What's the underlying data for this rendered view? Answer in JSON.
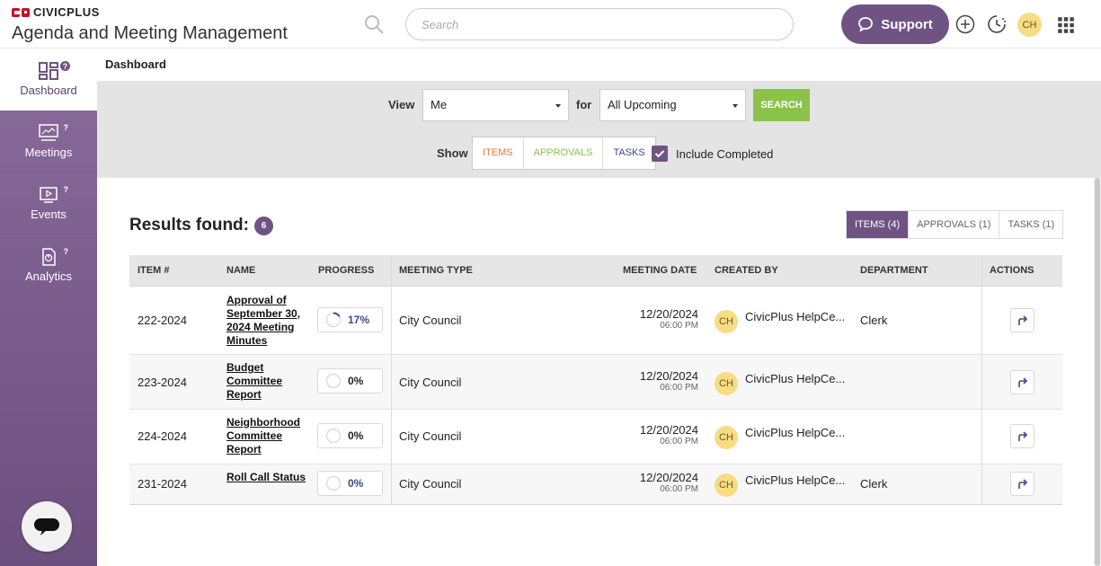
{
  "header": {
    "brand": "CIVICPLUS",
    "brand_civic": "CIVIC",
    "brand_plus": "PLUS",
    "app_title": "Agenda and Meeting Management",
    "search_placeholder": "Search",
    "support_label": "Support",
    "avatar_initials": "CH"
  },
  "sidebar": {
    "items": [
      {
        "label": "Dashboard",
        "icon": "dashboard-icon",
        "active": true
      },
      {
        "label": "Meetings",
        "icon": "meetings-icon",
        "active": false
      },
      {
        "label": "Events",
        "icon": "events-icon",
        "active": false
      },
      {
        "label": "Analytics",
        "icon": "analytics-icon",
        "active": false
      }
    ],
    "help_mark": "?"
  },
  "breadcrumb": "Dashboard",
  "filters": {
    "view_label": "View",
    "view_value": "Me",
    "for_label": "for",
    "for_value": "All Upcoming",
    "search_label": "SEARCH",
    "show_label": "Show",
    "toggles": [
      {
        "label": "ITEMS",
        "color": "#e07b39"
      },
      {
        "label": "APPROVALS",
        "color": "#8bc34a"
      },
      {
        "label": "TASKS",
        "color": "#3b4a8a"
      }
    ],
    "include_completed_label": "Include Completed",
    "include_completed": true
  },
  "results": {
    "title": "Results found:",
    "count": "6",
    "tabs": [
      {
        "label": "ITEMS (4)",
        "active": true
      },
      {
        "label": "APPROVALS (1)",
        "active": false
      },
      {
        "label": "TASKS (1)",
        "active": false
      }
    ]
  },
  "table": {
    "columns": [
      "ITEM #",
      "NAME",
      "PROGRESS",
      "MEETING TYPE",
      "MEETING DATE",
      "CREATED BY",
      "DEPARTMENT",
      "ACTIONS"
    ],
    "rows": [
      {
        "item": "222-2024",
        "name": "Approval of September 30, 2024 Meeting Minutes",
        "progress": "17%",
        "progress_value": 0.17,
        "progress_color": "#3b4a8a",
        "meeting_type": "City Council",
        "date": "12/20/2024",
        "time": "06:00 PM",
        "creator_initials": "CH",
        "creator": "CivicPlus HelpCe...",
        "department": "Clerk"
      },
      {
        "item": "223-2024",
        "name": "Budget Committee Report",
        "progress": "0%",
        "progress_value": 0,
        "progress_color": "#222222",
        "meeting_type": "City Council",
        "date": "12/20/2024",
        "time": "06:00 PM",
        "creator_initials": "CH",
        "creator": "CivicPlus HelpCe...",
        "department": ""
      },
      {
        "item": "224-2024",
        "name": "Neighborhood Committee Report",
        "progress": "0%",
        "progress_value": 0,
        "progress_color": "#222222",
        "meeting_type": "City Council",
        "date": "12/20/2024",
        "time": "06:00 PM",
        "creator_initials": "CH",
        "creator": "CivicPlus HelpCe...",
        "department": ""
      },
      {
        "item": "231-2024",
        "name": "Roll Call Status",
        "progress": "0%",
        "progress_value": 0,
        "progress_color": "#3b4a8a",
        "meeting_type": "City Council",
        "date": "12/20/2024",
        "time": "06:00 PM",
        "creator_initials": "CH",
        "creator": "CivicPlus HelpCe...",
        "department": "Clerk"
      }
    ]
  },
  "colors": {
    "accent": "#6f5384",
    "green": "#8bc34a",
    "avatar": "#f7dc83"
  }
}
